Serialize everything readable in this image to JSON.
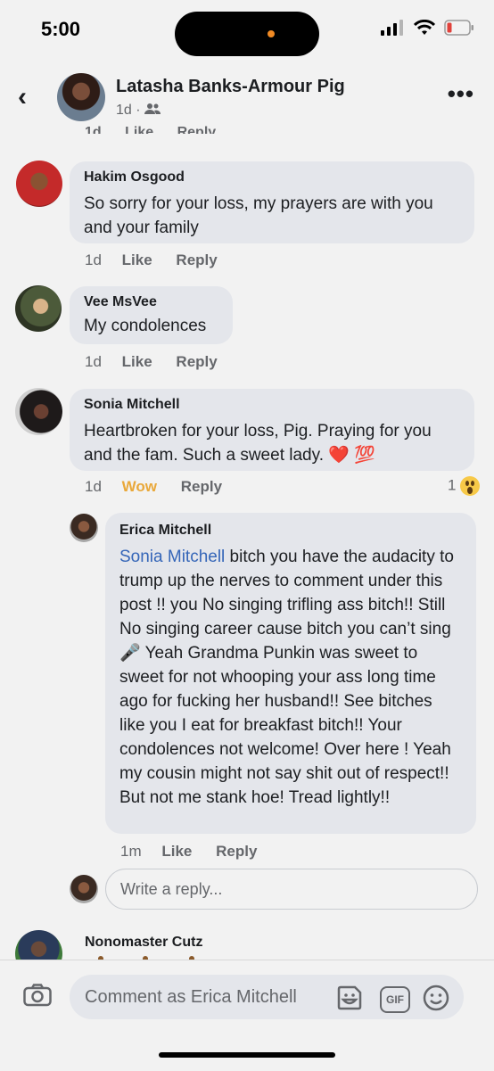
{
  "status_bar": {
    "time": "5:00"
  },
  "header": {
    "back_label": "‹",
    "name": "Latasha Banks-Armour Pig",
    "meta_time": "1d",
    "meta_separator": "·",
    "more_label": "•••"
  },
  "clipped_actions": {
    "time": "1d",
    "like": "Like",
    "reply": "Reply"
  },
  "comments": [
    {
      "author": "Hakim Osgood",
      "text": "So sorry for your loss, my prayers are with you and your family",
      "time": "1d",
      "like": "Like",
      "reply": "Reply"
    },
    {
      "author": "Vee MsVee",
      "text": "My condolences",
      "time": "1d",
      "like": "Like",
      "reply": "Reply"
    },
    {
      "author": "Sonia Mitchell",
      "text": "Heartbroken for your loss, Pig. Praying for you and the fam. Such a sweet lady. ❤️ 💯",
      "time": "1d",
      "like": "Wow",
      "reply": "Reply",
      "reaction_count": "1"
    },
    {
      "author": "Erica Mitchell",
      "mention": "Sonia Mitchell",
      "text": " bitch you have the audacity to trump up the nerves to comment under this post !! you No singing trifling ass bitch!! Still No singing career cause bitch you can’t sing 🎤 Yeah Grandma Punkin was sweet to sweet for not whooping your ass long time ago for fucking her husband!! See bitches like you I eat for breakfast bitch!! Your condolences not welcome! Over here ! Yeah my cousin might not say shit out of respect!! But not me stank hoe! Tread lightly!!",
      "time": "1m",
      "like": "Like",
      "reply": "Reply"
    }
  ],
  "reply_input": {
    "placeholder": "Write a reply..."
  },
  "next_comment": {
    "author": "Nonomaster Cutz"
  },
  "composer": {
    "placeholder": "Comment as Erica Mitchell",
    "gif_label": "GIF"
  }
}
